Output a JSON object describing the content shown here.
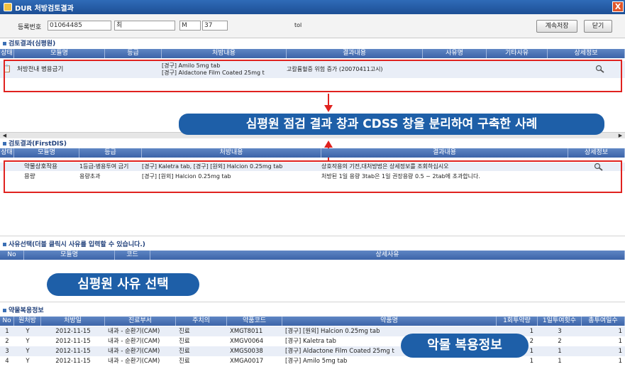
{
  "window": {
    "title": "DUR 처방검토결과",
    "close_label": "X"
  },
  "toolbar": {
    "reg_no_label": "등록번호",
    "reg_no_value": "01064485",
    "name_value": "최",
    "sex_value": "M",
    "age_value": "37",
    "mark": "tol",
    "continue_save_label": "계속저장",
    "close_label": "닫기"
  },
  "section1": {
    "title": "검토결과(심평원)",
    "columns": [
      "상태",
      "모듈명",
      "등급",
      "처방내용",
      "결과내용",
      "사유명",
      "기타사유",
      "상세정보"
    ],
    "rows": [
      {
        "module": "처방전내 병용금기",
        "grade": "",
        "drug1": "[경구] Amilo 5mg tab",
        "drug2": "[경구] Aldactone Film Coated 25mg t",
        "result": "고칼륨혈증 위험 증가 (20070411고시)"
      }
    ]
  },
  "banner_main": "심평원 점검 결과 창과 CDSS 창을 분리하여 구축한 사례",
  "section2": {
    "title": "검토결과(FirstDIS)",
    "columns": [
      "상태",
      "모듈명",
      "등급",
      "처방내용",
      "결과내용",
      "상세정보"
    ],
    "rows": [
      {
        "module": "약물상호작용",
        "grade": "1등급-병용투여 금기",
        "rx": "[경구] Kaletra tab, [경구] [원외] Halcion 0.25mg tab",
        "result": "상호작용의 기전,대처방법은 상세정보를 조회하십시오"
      },
      {
        "module": "용량",
        "grade": "용량초과",
        "rx": "[경구] [원외] Halcion 0.25mg tab",
        "result": "처방된 1일 용량 3tab은 1일 권장용량 0.5 ~ 2tab에 초과합니다."
      }
    ]
  },
  "section3": {
    "title": "사유선택(더블 클릭시 사유를 입력할 수 있습니다.)",
    "columns": [
      "No",
      "모듈명",
      "코드",
      "상세사유"
    ],
    "banner": "심평원 사유 선택"
  },
  "section4": {
    "title": "약물복용정보",
    "columns": [
      "No",
      "원처방",
      "처방일",
      "진료부서",
      "주치의",
      "약품코드",
      "약품명",
      "1회투약량",
      "1일투여횟수",
      "총투여일수"
    ],
    "rows": [
      {
        "no": "1",
        "orig": "Y",
        "date": "2012-11-15",
        "dept": "내과 - 순환기(CAM)",
        "doctor": "진료",
        "code": "XMGT8011",
        "name": "[경구] [원외] Halcion 0.25mg tab",
        "dose": "1",
        "freq": "3",
        "days": "1"
      },
      {
        "no": "2",
        "orig": "Y",
        "date": "2012-11-15",
        "dept": "내과 - 순환기(CAM)",
        "doctor": "진료",
        "code": "XMGV0064",
        "name": "[경구] Kaletra tab",
        "dose": "2",
        "freq": "2",
        "days": "1"
      },
      {
        "no": "3",
        "orig": "Y",
        "date": "2012-11-15",
        "dept": "내과 - 순환기(CAM)",
        "doctor": "진료",
        "code": "XMGS0038",
        "name": "[경구] Aldactone Film Coated 25mg t",
        "dose": "1",
        "freq": "1",
        "days": "1"
      },
      {
        "no": "4",
        "orig": "Y",
        "date": "2012-11-15",
        "dept": "내과 - 순환기(CAM)",
        "doctor": "진료",
        "code": "XMGA0017",
        "name": "[경구] Amilo 5mg tab",
        "dose": "1",
        "freq": "1",
        "days": "1"
      }
    ],
    "banner": "악물 복용정보"
  },
  "colors": {
    "header_blue": "#3c64a8",
    "banner_blue": "#1e5fa8",
    "highlight_red": "#e0221f"
  }
}
